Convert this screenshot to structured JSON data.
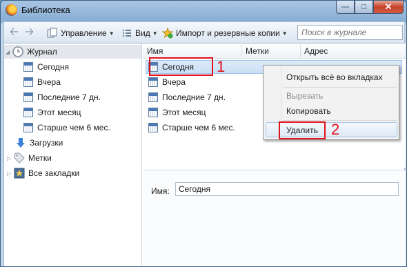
{
  "window": {
    "title": "Библиотека"
  },
  "toolbar": {
    "organize_label": "Управление",
    "views_label": "Вид",
    "import_label": "Импорт и резервные копии",
    "search_placeholder": "Поиск в журнале"
  },
  "sidebar": {
    "items": [
      {
        "label": "Журнал",
        "icon": "history-clock-icon",
        "level": 0,
        "selected": true,
        "expander": "open"
      },
      {
        "label": "Сегодня",
        "icon": "calendar-icon",
        "level": 1
      },
      {
        "label": "Вчера",
        "icon": "calendar-icon",
        "level": 1
      },
      {
        "label": "Последние 7 дн.",
        "icon": "calendar-icon",
        "level": 1
      },
      {
        "label": "Этот месяц",
        "icon": "calendar-icon",
        "level": 1
      },
      {
        "label": "Старше чем 6 мес.",
        "icon": "calendar-icon",
        "level": 1
      },
      {
        "label": "Загрузки",
        "icon": "download-arrow-icon",
        "level": 0
      },
      {
        "label": "Метки",
        "icon": "tag-icon",
        "level": 0,
        "expander": "closed"
      },
      {
        "label": "Все закладки",
        "icon": "star-bookmark-icon",
        "level": 0,
        "expander": "closed"
      }
    ]
  },
  "list": {
    "columns": [
      "Имя",
      "Метки",
      "Адрес"
    ],
    "rows": [
      "Сегодня",
      "Вчера",
      "Последние 7 дн.",
      "Этот месяц",
      "Старше чем 6 мес."
    ]
  },
  "annotations": {
    "first": "1",
    "second": "2"
  },
  "context_menu": {
    "items": [
      {
        "label": "Открыть всё во вкладках",
        "disabled": false
      },
      {
        "label": "Вырезать",
        "disabled": true
      },
      {
        "label": "Копировать",
        "disabled": false
      },
      {
        "label": "Удалить",
        "disabled": false,
        "highlighted": true
      }
    ]
  },
  "detail": {
    "name_label": "Имя:",
    "name_value": "Сегодня"
  },
  "colors": {
    "annotation_red": "#e0121a",
    "selection": "#c9dff6",
    "window_frame": "#88aed4"
  }
}
